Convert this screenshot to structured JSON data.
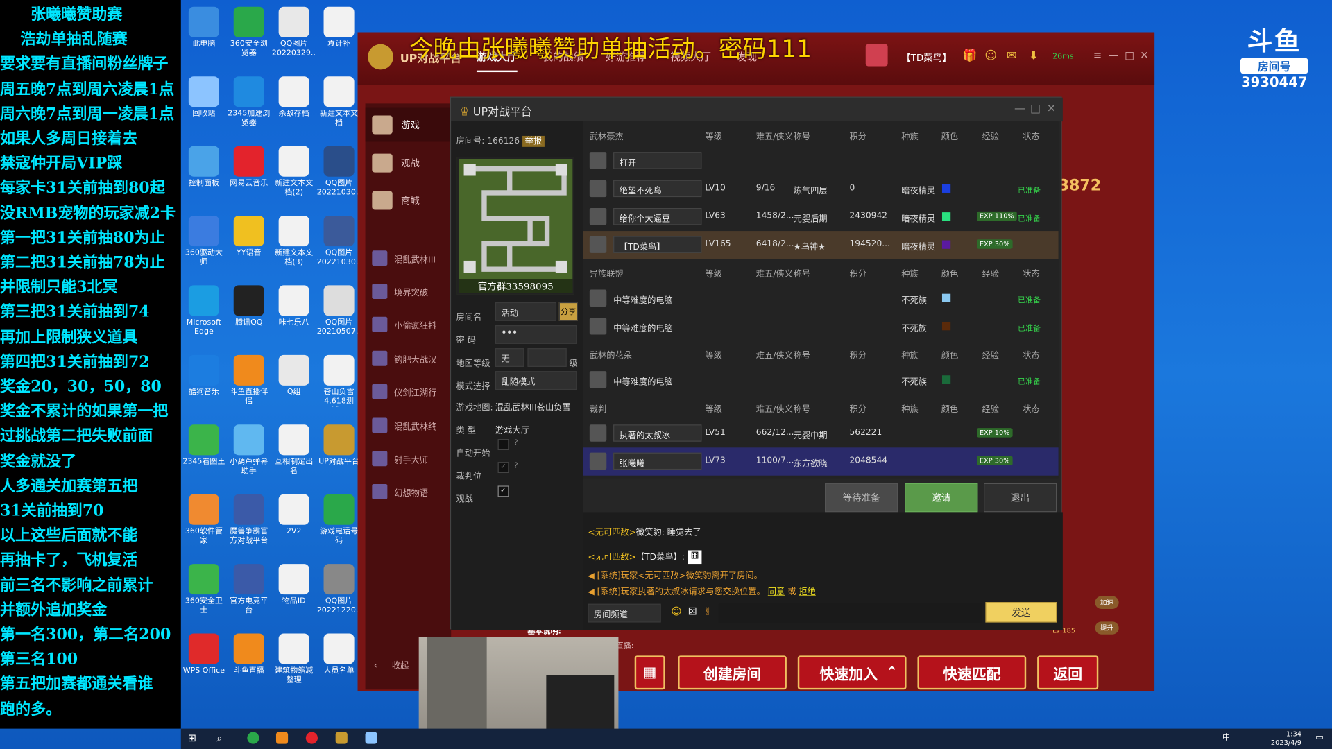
{
  "overlay_lines": [
    "张曦曦赞助赛",
    "浩劫单抽乱随赛",
    "要求要有直播间粉丝牌子",
    "周五晚7点到周六凌晨1点",
    "周六晚7点到周一凌晨1点",
    "如果人多周日接着去",
    "禁寇仲开局VIP踩",
    "每家卡31关前抽到80起",
    "没RMB宠物的玩家减2卡",
    "第一把31关前抽80为止",
    "第二把31关前抽78为止",
    "并限制只能3北冥",
    "第三把31关前抽到74",
    "再加上限制狭义道具",
    "第四把31关前抽到72",
    "奖金20，30，50，80",
    "奖金不累计的如果第一把",
    "过挑战第二把失败前面",
    "奖金就没了",
    "人多通关加赛第五把",
    "31关前抽到70",
    "以上这些后面就不能",
    "再抽卡了，飞机复活",
    "前三名不影响之前累计",
    "并额外追加奖金",
    "第一名300，第二名200",
    "第三名100",
    "第五把加赛都通关看谁",
    "跑的多。"
  ],
  "desktop_icons": [
    {
      "label": "此电脑",
      "icon": "computer-icon",
      "color": "#3a8de0"
    },
    {
      "label": "360安全浏览器",
      "icon": "browser-icon",
      "color": "#2aa84a"
    },
    {
      "label": "QQ图片20220329...",
      "icon": "image-icon",
      "color": "#e8e8e8"
    },
    {
      "label": "袁计补",
      "icon": "document-icon",
      "color": "#f2f2f2"
    },
    {
      "label": "回收站",
      "icon": "recycle-bin-icon",
      "color": "#8cc4ff"
    },
    {
      "label": "2345加速浏览器",
      "icon": "browser-icon",
      "color": "#1f8ae0"
    },
    {
      "label": "杀敌存档",
      "icon": "document-icon",
      "color": "#f2f2f2"
    },
    {
      "label": "新建文本文档",
      "icon": "document-icon",
      "color": "#f2f2f2"
    },
    {
      "label": "控制面板",
      "icon": "control-panel-icon",
      "color": "#4aa3e8"
    },
    {
      "label": "网易云音乐",
      "icon": "music-icon",
      "color": "#e3232c"
    },
    {
      "label": "新建文本文档(2)",
      "icon": "document-icon",
      "color": "#f2f2f2"
    },
    {
      "label": "QQ图片20221030...",
      "icon": "image-icon",
      "color": "#2a4e8a"
    },
    {
      "label": "360驱动大师",
      "icon": "driver-icon",
      "color": "#3b7ce0"
    },
    {
      "label": "YY语音",
      "icon": "voice-icon",
      "color": "#f0c020"
    },
    {
      "label": "新建文本文档(3)",
      "icon": "document-icon",
      "color": "#f2f2f2"
    },
    {
      "label": "QQ图片20221030...",
      "icon": "image-icon",
      "color": "#3b5a9a"
    },
    {
      "label": "Microsoft Edge",
      "icon": "edge-icon",
      "color": "#1b9de2"
    },
    {
      "label": "腾讯QQ",
      "icon": "qq-icon",
      "color": "#222"
    },
    {
      "label": "咔七乐八",
      "icon": "document-icon",
      "color": "#f2f2f2"
    },
    {
      "label": "QQ图片20210507...",
      "icon": "image-icon",
      "color": "#ddd"
    },
    {
      "label": "酷狗音乐",
      "icon": "music-icon",
      "color": "#1c7de0"
    },
    {
      "label": "斗鱼直播伴侣",
      "icon": "live-icon",
      "color": "#f08a1c"
    },
    {
      "label": "Q组",
      "icon": "archive-icon",
      "color": "#e8e8e8"
    },
    {
      "label": "苍山负雪4.618测试...",
      "icon": "document-icon",
      "color": "#f2f2f2"
    },
    {
      "label": "2345看图王",
      "icon": "image-viewer-icon",
      "color": "#3bb44a"
    },
    {
      "label": "小葫芦弹幕助手",
      "icon": "danmaku-icon",
      "color": "#60b8f0"
    },
    {
      "label": "互相制定出名",
      "icon": "document-icon",
      "color": "#f2f2f2"
    },
    {
      "label": "UP对战平台",
      "icon": "game-platform-icon",
      "color": "#c89a30"
    },
    {
      "label": "360软件管家",
      "icon": "software-icon",
      "color": "#f08a30"
    },
    {
      "label": "魔兽争霸官方对战平台",
      "icon": "warcraft-icon",
      "color": "#3b5aa8"
    },
    {
      "label": "2V2",
      "icon": "document-icon",
      "color": "#f2f2f2"
    },
    {
      "label": "游戏电话号码",
      "icon": "document-icon",
      "color": "#2aa84a"
    },
    {
      "label": "360安全卫士",
      "icon": "security-icon",
      "color": "#3bb44a"
    },
    {
      "label": "官方电竞平台",
      "icon": "esports-icon",
      "color": "#3b5aa8"
    },
    {
      "label": "物品ID",
      "icon": "document-icon",
      "color": "#f2f2f2"
    },
    {
      "label": "QQ图片20221220...",
      "icon": "image-icon",
      "color": "#888"
    },
    {
      "label": "WPS Office",
      "icon": "wps-icon",
      "color": "#e02a2a"
    },
    {
      "label": "斗鱼直播",
      "icon": "live-icon",
      "color": "#f08a1c"
    },
    {
      "label": "建筑物缩减整理",
      "icon": "document-icon",
      "color": "#f2f2f2"
    },
    {
      "label": "人员名单",
      "icon": "document-icon",
      "color": "#f2f2f2"
    }
  ],
  "game": {
    "banner": "今晚由张曦曦赞助单抽活动。密码111",
    "logo": "UP对战平台",
    "nav": [
      "游戏大厅",
      "我的战绩",
      "好游推荐",
      "视频大厅",
      "发现"
    ],
    "user": "【TD菜鸟】",
    "ping": "26ms",
    "side": [
      {
        "label": "游戏"
      },
      {
        "label": "观战"
      },
      {
        "label": "商城"
      }
    ],
    "maps": [
      "混乱武林III",
      "境界突破",
      "小偷疯狂抖",
      "钩肥大战汉",
      "仪剑江湖行",
      "混乱武林终",
      "射手大师",
      "幻想物语"
    ],
    "collapse": "收起",
    "bottom_buttons": [
      "创建房间",
      "快速加入",
      "快速匹配",
      "返回"
    ],
    "side_score": "3872",
    "right_tags": [
      "加速",
      "提升"
    ],
    "peek_text": [
      "基本说明:",
      "直播:"
    ],
    "peek_level": "LV 185"
  },
  "dialog": {
    "title": "UP对战平台",
    "room_no_label": "房间号:",
    "room_no": "166126",
    "report": "举报",
    "minimap_caption": "官方群33598095",
    "fields": [
      {
        "label": "房间名",
        "value": "活动",
        "extra": "分享"
      },
      {
        "label": "密 码",
        "value": "•••"
      },
      {
        "label": "地图等级",
        "value": "无",
        "extra": "级"
      },
      {
        "label": "模式选择",
        "value": "乱随模式"
      },
      {
        "label": "游戏地图:",
        "value": "混乱武林III苍山负雪"
      },
      {
        "label": "类 型",
        "value": "游戏大厅"
      },
      {
        "label": "自动开始",
        "value": ""
      },
      {
        "label": "裁判位",
        "value": ""
      },
      {
        "label": "观战",
        "value": ""
      }
    ],
    "columns": [
      "等级",
      "难五/侠义",
      "称号",
      "积分",
      "种族",
      "颜色",
      "经验",
      "状态"
    ],
    "teams": [
      {
        "name": "武林豪杰",
        "rows": [
          {
            "name": "打开",
            "level": "",
            "dn": "",
            "title": "",
            "score": "",
            "race": "",
            "color": "",
            "exp": "",
            "status": ""
          },
          {
            "name": "绝望不死鸟",
            "level": "LV10",
            "dn": "9/16",
            "title": "炼气四层",
            "score": "0",
            "race": "暗夜精灵",
            "color": "#1b3fe0",
            "exp": "",
            "status": "已准备"
          },
          {
            "name": "给你个大逼豆",
            "level": "LV63",
            "dn": "1458/2...",
            "title": "元婴后期",
            "score": "2430942",
            "race": "暗夜精灵",
            "color": "#2ae080",
            "exp": "EXP 110%",
            "status": "已准备"
          },
          {
            "name": "【TD菜鸟】",
            "level": "LV165",
            "dn": "6418/2...",
            "title": "★乌神★",
            "score": "194520...",
            "race": "暗夜精灵",
            "color": "#5a1aa0",
            "exp": "EXP 30%",
            "status": ""
          }
        ]
      },
      {
        "name": "异族联盟",
        "rows": [
          {
            "name": "中等难度的电脑",
            "level": "",
            "dn": "",
            "title": "",
            "score": "",
            "race": "不死族",
            "color": "#8ac8f0",
            "exp": "",
            "status": "已准备"
          },
          {
            "name": "中等难度的电脑",
            "level": "",
            "dn": "",
            "title": "",
            "score": "",
            "race": "不死族",
            "color": "#5a2a0a",
            "exp": "",
            "status": "已准备"
          }
        ]
      },
      {
        "name": "武林的花朵",
        "rows": [
          {
            "name": "中等难度的电脑",
            "level": "",
            "dn": "",
            "title": "",
            "score": "",
            "race": "不死族",
            "color": "#1a6a3a",
            "exp": "",
            "status": "已准备"
          }
        ]
      },
      {
        "name": "裁判",
        "rows": [
          {
            "name": "执著的太叔冰",
            "level": "LV51",
            "dn": "662/12...",
            "title": "元婴中期",
            "score": "562221",
            "race": "",
            "color": "",
            "exp": "EXP 10%",
            "status": ""
          },
          {
            "name": "张曦曦",
            "level": "LV73",
            "dn": "1100/7...",
            "title": "东方欲晓",
            "score": "2048544",
            "race": "",
            "color": "",
            "exp": "EXP 30%",
            "status": ""
          }
        ]
      }
    ],
    "buttons": [
      "等待准备",
      "邀请",
      "退出"
    ],
    "chat": [
      {
        "tag": "<无可匹敌>",
        "name": "微笑豹",
        "text": ": 睡觉去了"
      },
      {
        "tag": "<无可匹敌>",
        "name": "【TD菜鸟】",
        "text": ":"
      },
      {
        "text": "[系统]玩家<无可匹敌>微笑豹离开了房间。"
      },
      {
        "text": "[系统]玩家执著的太叔冰请求与您交换位置。",
        "accept": "同意",
        "or": "或",
        "reject": "拒绝"
      }
    ],
    "chat_channel": "房间频道",
    "send": "发送"
  },
  "logo": {
    "brand": "斗鱼",
    "label": "房间号",
    "room": "3930447"
  },
  "taskbar": {
    "time": "1:34",
    "date": "2023/4/9",
    "ime": "中"
  }
}
